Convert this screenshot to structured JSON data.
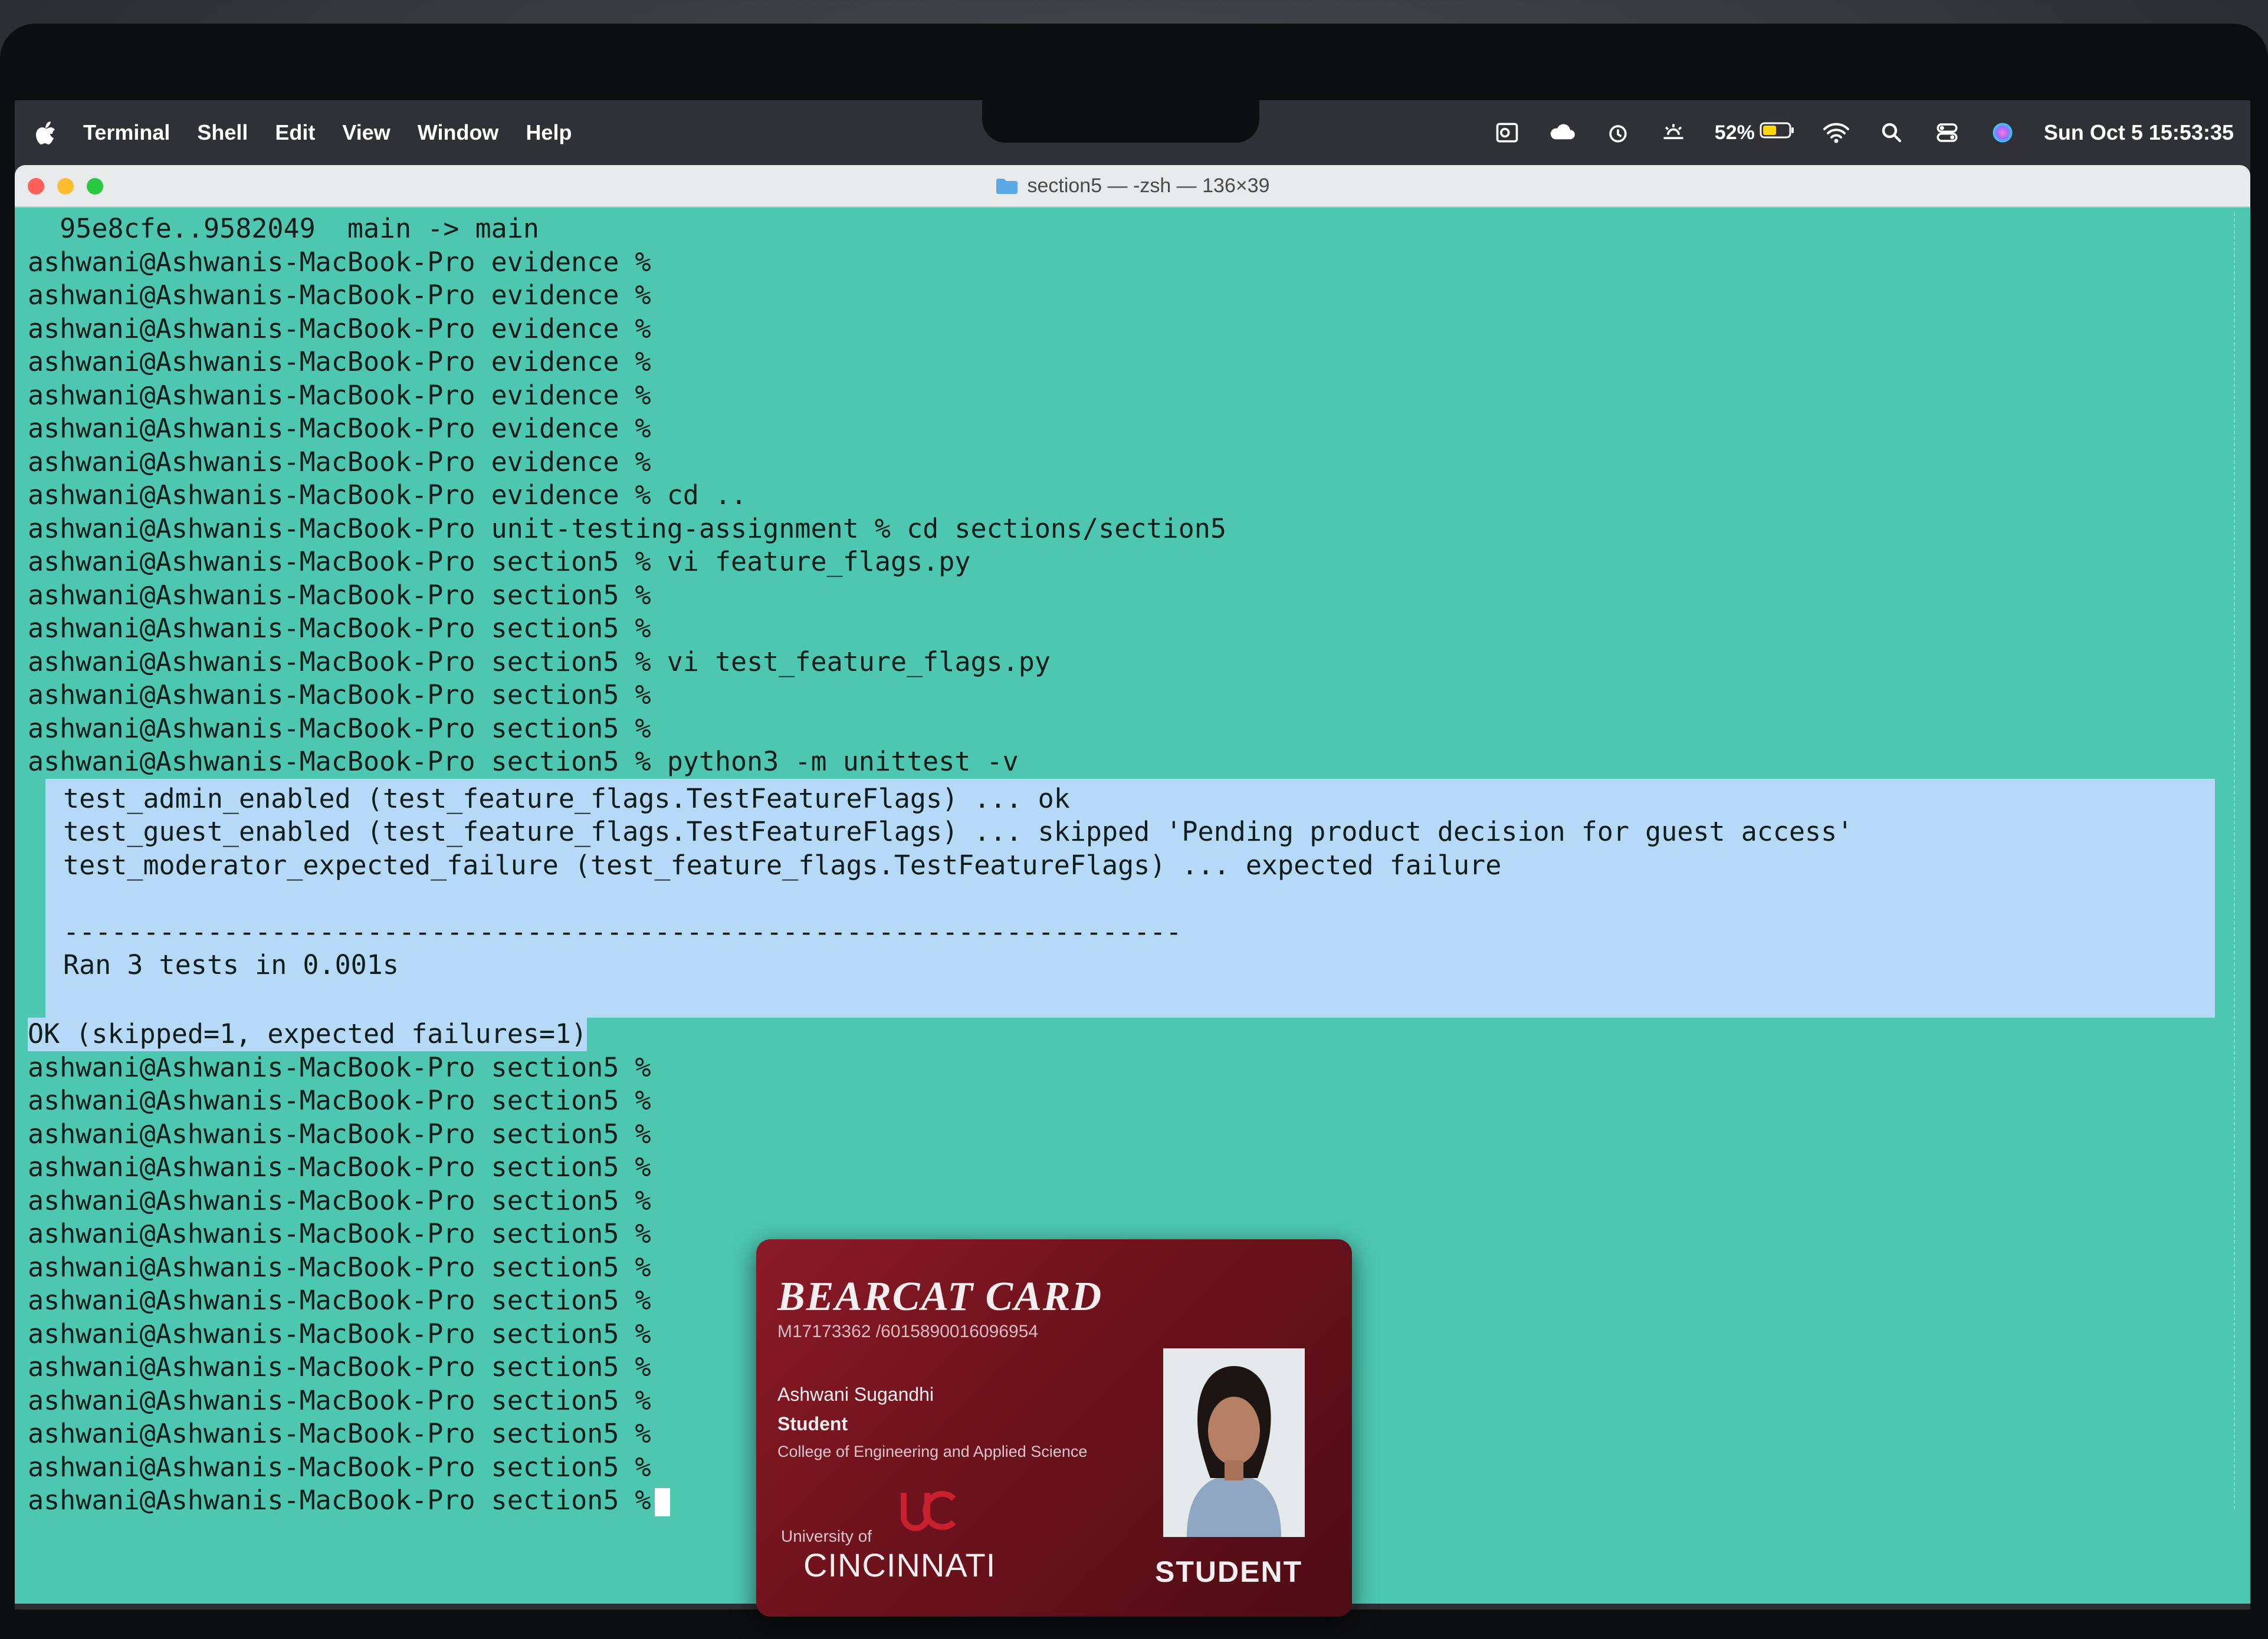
{
  "menubar": {
    "app_name": "Terminal",
    "items": [
      "Shell",
      "Edit",
      "View",
      "Window",
      "Help"
    ],
    "battery_percent": "52%",
    "clock": "Sun Oct 5  15:53:35"
  },
  "window": {
    "title": "section5 — -zsh — 136×39"
  },
  "terminal": {
    "top_lines": [
      "  95e8cfe..9582049  main -> main",
      "ashwani@Ashwanis-MacBook-Pro evidence %",
      "ashwani@Ashwanis-MacBook-Pro evidence %",
      "ashwani@Ashwanis-MacBook-Pro evidence %",
      "ashwani@Ashwanis-MacBook-Pro evidence %",
      "ashwani@Ashwanis-MacBook-Pro evidence %",
      "ashwani@Ashwanis-MacBook-Pro evidence %",
      "ashwani@Ashwanis-MacBook-Pro evidence %",
      "ashwani@Ashwanis-MacBook-Pro evidence % cd ..",
      "ashwani@Ashwanis-MacBook-Pro unit-testing-assignment % cd sections/section5",
      "ashwani@Ashwanis-MacBook-Pro section5 % vi feature_flags.py",
      "ashwani@Ashwanis-MacBook-Pro section5 %",
      "ashwani@Ashwanis-MacBook-Pro section5 %",
      "ashwani@Ashwanis-MacBook-Pro section5 % vi test_feature_flags.py",
      "ashwani@Ashwanis-MacBook-Pro section5 %",
      "ashwani@Ashwanis-MacBook-Pro section5 %",
      "ashwani@Ashwanis-MacBook-Pro section5 % python3 -m unittest -v"
    ],
    "selected_lines": [
      "test_admin_enabled (test_feature_flags.TestFeatureFlags) ... ok",
      "test_guest_enabled (test_feature_flags.TestFeatureFlags) ... skipped 'Pending product decision for guest access'",
      "test_moderator_expected_failure (test_feature_flags.TestFeatureFlags) ... expected failure",
      "",
      "----------------------------------------------------------------------",
      "Ran 3 tests in 0.001s",
      ""
    ],
    "result_line": "OK (skipped=1, expected failures=1)",
    "bottom_lines": [
      "ashwani@Ashwanis-MacBook-Pro section5 %",
      "ashwani@Ashwanis-MacBook-Pro section5 %",
      "ashwani@Ashwanis-MacBook-Pro section5 %",
      "ashwani@Ashwanis-MacBook-Pro section5 %",
      "ashwani@Ashwanis-MacBook-Pro section5 %",
      "ashwani@Ashwanis-MacBook-Pro section5 %",
      "ashwani@Ashwanis-MacBook-Pro section5 %",
      "ashwani@Ashwanis-MacBook-Pro section5 %",
      "ashwani@Ashwanis-MacBook-Pro section5 %",
      "ashwani@Ashwanis-MacBook-Pro section5 %",
      "ashwani@Ashwanis-MacBook-Pro section5 %",
      "ashwani@Ashwanis-MacBook-Pro section5 %",
      "ashwani@Ashwanis-MacBook-Pro section5 %"
    ],
    "prompt_line": "ashwani@Ashwanis-MacBook-Pro section5 %",
    "colors": {
      "background": "#4dc7b0",
      "selection": "#b6d9f7",
      "text": "#0c1d1b"
    }
  },
  "id_card": {
    "title": "BEARCAT CARD",
    "number": "M17173362 /6015890016096954",
    "name": "Ashwani Sugandhi",
    "role": "Student",
    "college": "College of Engineering and Applied Science",
    "university_small": "University of",
    "university": "CINCINNATI",
    "badge": "STUDENT"
  }
}
